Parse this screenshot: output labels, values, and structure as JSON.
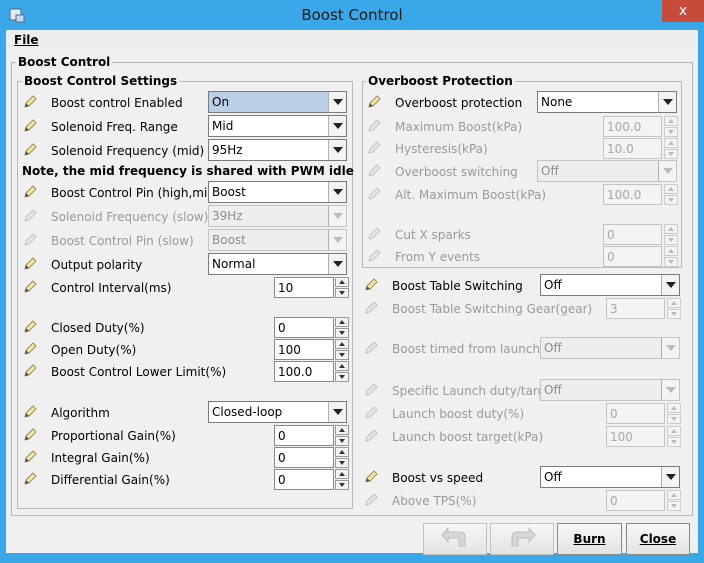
{
  "window": {
    "title": "Boost Control",
    "close_glyph": "x"
  },
  "menu": {
    "file": "File"
  },
  "panel_title": "Boost Control",
  "left": {
    "title": "Boost Control Settings",
    "note": "Note, the mid frequency is shared with PWM idle",
    "fields": {
      "boost_enabled": {
        "label": "Boost control Enabled",
        "value": "On"
      },
      "freq_range": {
        "label": "Solenoid Freq. Range",
        "value": "Mid"
      },
      "freq_mid": {
        "label": "Solenoid Frequency (mid)",
        "value": "95Hz"
      },
      "pin_high_mid": {
        "label": "Boost Control Pin (high,mid)",
        "value": "Boost"
      },
      "freq_slow": {
        "label": "Solenoid Frequency (slow)",
        "value": "39Hz"
      },
      "pin_slow": {
        "label": "Boost Control Pin (slow)",
        "value": "Boost"
      },
      "output_polarity": {
        "label": "Output polarity",
        "value": "Normal"
      },
      "control_interval": {
        "label": "Control Interval(ms)",
        "value": "10"
      },
      "closed_duty": {
        "label": "Closed Duty(%)",
        "value": "0"
      },
      "open_duty": {
        "label": "Open Duty(%)",
        "value": "100"
      },
      "lower_limit": {
        "label": "Boost Control Lower Limit(%)",
        "value": "100.0"
      },
      "algorithm": {
        "label": "Algorithm",
        "value": "Closed-loop"
      },
      "p_gain": {
        "label": "Proportional Gain(%)",
        "value": "0"
      },
      "i_gain": {
        "label": "Integral Gain(%)",
        "value": "0"
      },
      "d_gain": {
        "label": "Differential Gain(%)",
        "value": "0"
      }
    }
  },
  "overboost": {
    "title": "Overboost Protection",
    "fields": {
      "protection": {
        "label": "Overboost protection",
        "value": "None"
      },
      "max_boost": {
        "label": "Maximum Boost(kPa)",
        "value": "100.0"
      },
      "hysteresis": {
        "label": "Hysteresis(kPa)",
        "value": "10.0"
      },
      "switching": {
        "label": "Overboost switching",
        "value": "Off"
      },
      "alt_max_boost": {
        "label": "Alt. Maximum Boost(kPa)",
        "value": "100.0"
      },
      "cut_x_sparks": {
        "label": "Cut X sparks",
        "value": "0"
      },
      "from_y_events": {
        "label": "From Y events",
        "value": "0"
      }
    }
  },
  "right": {
    "fields": {
      "table_switching": {
        "label": "Boost Table Switching",
        "value": "Off"
      },
      "switching_gear": {
        "label": "Boost Table Switching Gear(gear)",
        "value": "3"
      },
      "timed_from_launch": {
        "label": "Boost timed from launch",
        "value": "Off"
      },
      "specific_launch": {
        "label": "Specific Launch duty/target",
        "value": "Off"
      },
      "launch_duty": {
        "label": "Launch boost duty(%)",
        "value": "0"
      },
      "launch_target": {
        "label": "Launch boost target(kPa)",
        "value": "100"
      },
      "vs_speed": {
        "label": "Boost vs speed",
        "value": "Off"
      },
      "above_tps": {
        "label": "Above TPS(%)",
        "value": "0"
      }
    }
  },
  "buttons": {
    "burn": "Burn",
    "close": "Close"
  },
  "icons": {
    "app": "app-icon",
    "pencil": "pencil-icon",
    "undo": "undo-arrow-icon",
    "redo": "redo-arrow-icon"
  }
}
